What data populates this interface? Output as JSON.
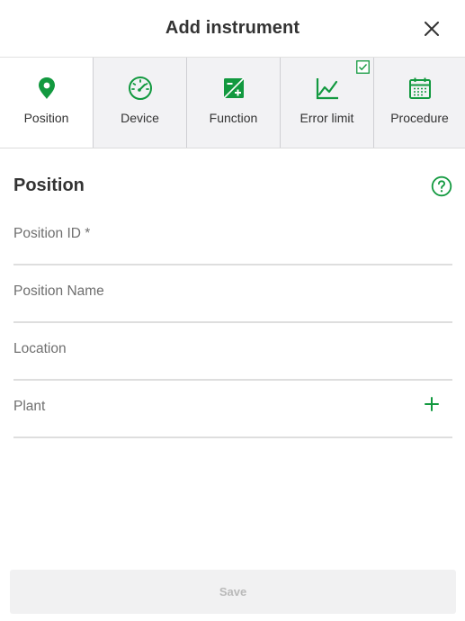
{
  "header": {
    "title": "Add instrument",
    "close_icon": "close-icon"
  },
  "tabs": [
    {
      "label": "Position",
      "icon": "map-pin-icon",
      "active": true
    },
    {
      "label": "Device",
      "icon": "gauge-icon",
      "active": false
    },
    {
      "label": "Function",
      "icon": "function-icon",
      "active": false
    },
    {
      "label": "Error limit",
      "icon": "line-chart-icon",
      "active": false,
      "checked": true
    },
    {
      "label": "Procedure",
      "icon": "calendar-icon",
      "active": false
    }
  ],
  "section": {
    "title": "Position",
    "help_icon": "help-icon"
  },
  "fields": {
    "position_id": {
      "label": "Position ID *",
      "value": ""
    },
    "position_name": {
      "label": "Position Name",
      "value": ""
    },
    "location": {
      "label": "Location",
      "value": ""
    },
    "plant": {
      "label": "Plant",
      "value": "",
      "add_icon": "plus-icon"
    }
  },
  "footer": {
    "save_label": "Save"
  },
  "colors": {
    "accent": "#12993f",
    "tab_bg": "#f2f2f4",
    "disabled_text": "#b9b9b9"
  }
}
